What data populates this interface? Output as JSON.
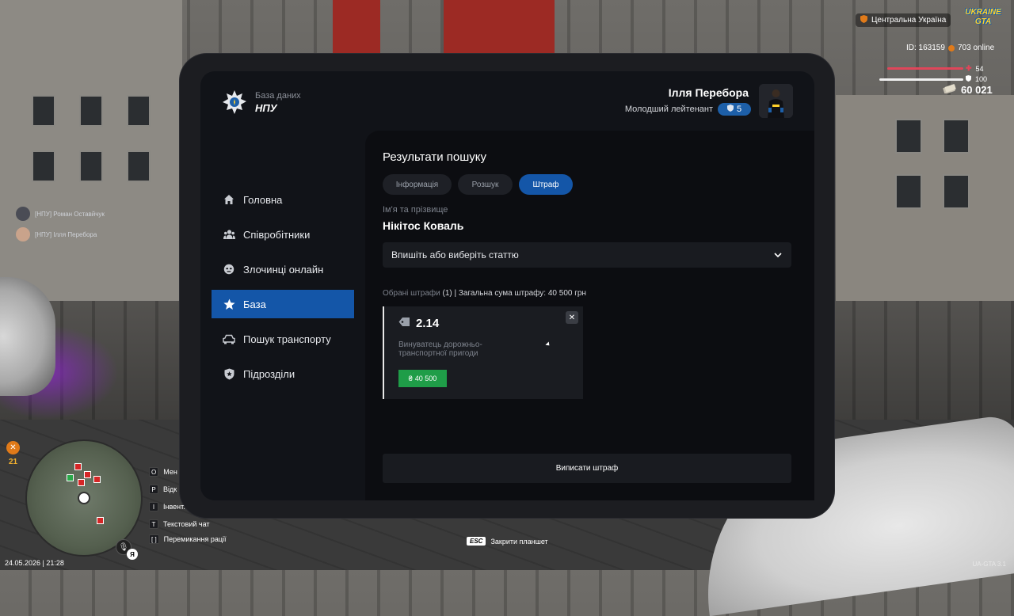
{
  "app": {
    "logo_subtitle": "База даних",
    "logo_title": "НПУ"
  },
  "user": {
    "name": "Ілля Перебора",
    "rank": "Молодший лейтенант",
    "rank_level": "5"
  },
  "sidebar": {
    "items": [
      {
        "label": "Головна",
        "icon": "home-icon",
        "active": false
      },
      {
        "label": "Співробітники",
        "icon": "people-icon",
        "active": false
      },
      {
        "label": "Злочинці онлайн",
        "icon": "mask-icon",
        "active": false
      },
      {
        "label": "База",
        "icon": "star-icon",
        "active": true
      },
      {
        "label": "Пошук транспорту",
        "icon": "car-icon",
        "active": false
      },
      {
        "label": "Підрозділи",
        "icon": "shield-icon",
        "active": false
      }
    ]
  },
  "main": {
    "title": "Результати пошуку",
    "tabs": [
      {
        "label": "Інформація",
        "active": false
      },
      {
        "label": "Розшук",
        "active": false
      },
      {
        "label": "Штраф",
        "active": true
      }
    ],
    "name_label": "Ім'я та прізвище",
    "name_value": "Нікітос Коваль",
    "select_placeholder": "Впишіть або виберіть статтю",
    "summary_muted": "Обрані штрафи",
    "summary_text": "(1) | Загальна сума штрафу: 40 500 грн",
    "fine": {
      "code": "2.14",
      "description": "Винуватець дорожньо-транспортної пригоди",
      "currency_symbol": "₴",
      "amount": "40 500"
    },
    "submit_label": "Виписати штраф"
  },
  "hud": {
    "region": "Центральна Україна",
    "logo_line1": "UKRAINE",
    "logo_line2": "GTA",
    "player_id": "ID: 163159",
    "online": "703 online",
    "health": "54",
    "armor": "100",
    "money": "60 021",
    "hunger": "21",
    "datetime": "24.05.2026 | 21:28",
    "language": "Я",
    "esc_key": "ESC",
    "esc_label": "Закрити планшет",
    "watermark": "UA-GTA 3.1",
    "accent_colors": {
      "primary": "#1456a8",
      "money_green": "#1f9d48",
      "health": "#e0465a"
    }
  },
  "chat": [
    {
      "text": "[НПУ] Роман Оставйчук"
    },
    {
      "text": "[НПУ] Ілля Перебора"
    }
  ],
  "keybinds": [
    {
      "key": "O",
      "label": "Мен"
    },
    {
      "key": "P",
      "label": "Відк"
    },
    {
      "key": "I",
      "label": "Інвент."
    },
    {
      "key": "T",
      "label": "Текстовий чат"
    },
    {
      "key": "[ ]",
      "label": "Перемикання рації"
    }
  ]
}
